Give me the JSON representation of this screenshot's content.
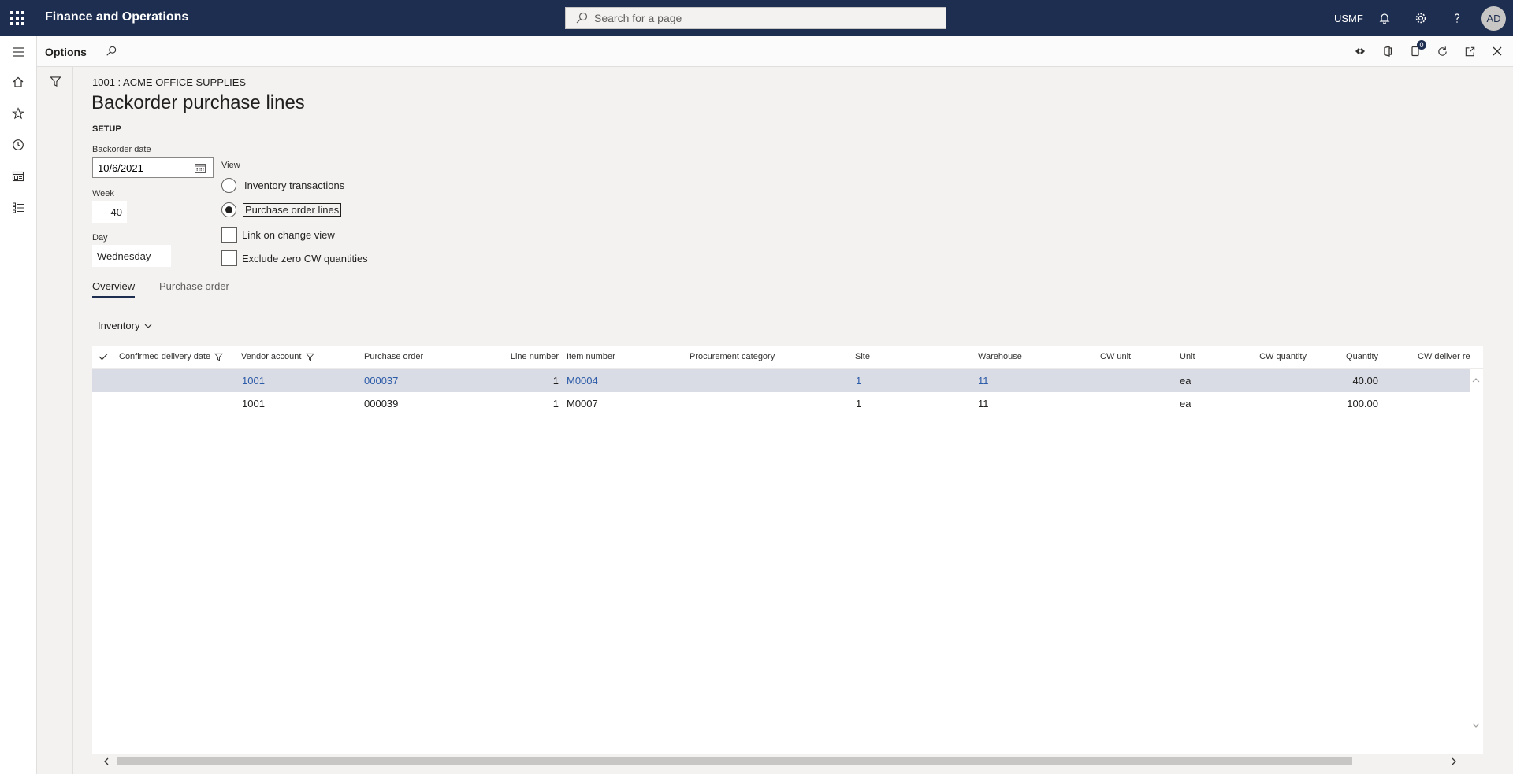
{
  "app": {
    "title": "Finance and Operations"
  },
  "topbar": {
    "search_placeholder": "Search for a page",
    "company": "USMF",
    "avatar_initials": "AD"
  },
  "actionbar": {
    "options_label": "Options",
    "attach_badge": "0"
  },
  "page": {
    "breadcrumb": "1001 : ACME OFFICE SUPPLIES",
    "title": "Backorder purchase lines",
    "section": "SETUP"
  },
  "setup": {
    "backorder_date_label": "Backorder date",
    "backorder_date_value": "10/6/2021",
    "week_label": "Week",
    "week_value": "40",
    "day_label": "Day",
    "day_value": "Wednesday",
    "view_label": "View",
    "view_options": [
      "Inventory transactions",
      "Purchase order lines"
    ],
    "view_selected": "Purchase order lines",
    "link_on_change_view": "Link on change view",
    "exclude_zero_cw": "Exclude zero CW quantities"
  },
  "tabs": [
    "Overview",
    "Purchase order"
  ],
  "grid_menu": {
    "label": "Inventory"
  },
  "grid": {
    "columns": [
      "Confirmed delivery date",
      "Vendor account",
      "Purchase order",
      "Line number",
      "Item number",
      "Procurement category",
      "Site",
      "Warehouse",
      "CW unit",
      "Unit",
      "CW quantity",
      "Quantity",
      "CW deliver re"
    ],
    "rows": [
      {
        "confirmed_delivery_date": "",
        "vendor_account": "1001",
        "purchase_order": "000037",
        "line_number": "1",
        "item_number": "M0004",
        "procurement_category": "",
        "site": "1",
        "warehouse": "11",
        "cw_unit": "",
        "unit": "ea",
        "cw_quantity": "",
        "quantity": "40.00",
        "cw_deliver_remainder": ""
      },
      {
        "confirmed_delivery_date": "",
        "vendor_account": "1001",
        "purchase_order": "000039",
        "line_number": "1",
        "item_number": "M0007",
        "procurement_category": "",
        "site": "1",
        "warehouse": "11",
        "cw_unit": "",
        "unit": "ea",
        "cw_quantity": "",
        "quantity": "100.00",
        "cw_deliver_remainder": ""
      }
    ]
  },
  "colors": {
    "nav": "#1e2e50",
    "link": "#2c5ba8",
    "selected_row": "#d9dce4"
  }
}
